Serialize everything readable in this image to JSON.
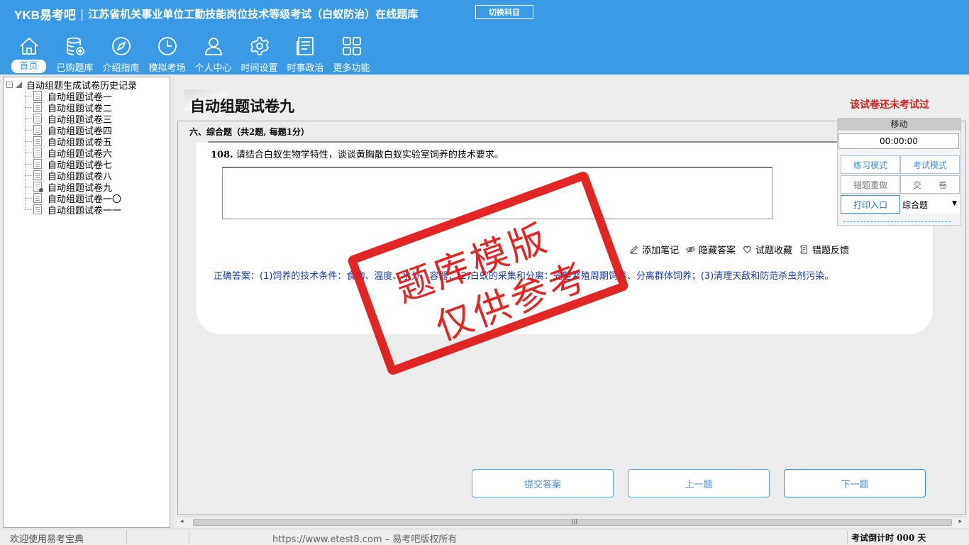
{
  "app": {
    "logo": "YKB易考吧",
    "title": "江苏省机关事业单位工勤技能岗位技术等级考试（白蚁防治）在线题库",
    "switch_subject": "切换科目"
  },
  "nav": {
    "items": [
      {
        "label": "首页",
        "icon": "home-icon"
      },
      {
        "label": "已购题库",
        "icon": "database-icon"
      },
      {
        "label": "介绍指南",
        "icon": "compass-icon"
      },
      {
        "label": "模拟考场",
        "icon": "clock-icon"
      },
      {
        "label": "个人中心",
        "icon": "user-icon"
      },
      {
        "label": "时间设置",
        "icon": "gear-icon"
      },
      {
        "label": "时事政治",
        "icon": "newspaper-icon"
      },
      {
        "label": "更多功能",
        "icon": "grid-icon"
      }
    ],
    "active": "首页"
  },
  "tree": {
    "root": "自动组题生成试卷历史记录",
    "expander": "-",
    "items": [
      "自动组题试卷一",
      "自动组题试卷二",
      "自动组题试卷三",
      "自动组题试卷四",
      "自动组题试卷五",
      "自动组题试卷六",
      "自动组题试卷七",
      "自动组题试卷八",
      "自动组题试卷九",
      "自动组题试卷一〇",
      "自动组题试卷一一"
    ],
    "current": "自动组题试卷九"
  },
  "paper": {
    "title": "自动组题试卷九",
    "status": "该试卷还未考试过",
    "section": "六、综合题（共2题, 每题1分）"
  },
  "question": {
    "number": "108.",
    "text": "请结合白蚁生物学特性，谈谈黄胸散白蚁实验室饲养的技术要求。",
    "answer_value": "",
    "correct_answer": "正确答案：(1)饲养的技术条件：食物、温度、水分、容器；(2)白蚁的采集和分离：完整繁殖周期饲养、分离群体饲养；(3)清理天敌和防范杀虫剂污染。"
  },
  "tools": {
    "note": "添加笔记",
    "hide_answer": "隐藏答案",
    "favorite": "试题收藏",
    "feedback": "错题反馈"
  },
  "actions": {
    "submit": "提交答案",
    "prev": "上一题",
    "next": "下一题"
  },
  "control": {
    "header": "移动",
    "timer": "00:00:00",
    "practice_mode": "练习模式",
    "exam_mode": "考试模式",
    "redo_wrong": "错题重做",
    "hand_in": "交　　卷",
    "print": "打印入口",
    "type_selected": "综合题"
  },
  "watermark": {
    "line1": "题库模版",
    "line2": "仅供参考"
  },
  "statusbar": {
    "welcome": "欢迎使用易考宝典",
    "copyright": "https://www.etest8.com – 易考吧版权所有",
    "countdown": "考试倒计时 000 天"
  },
  "colors": {
    "header_bg": "#3a9ae6",
    "stamp": "#e01414",
    "status_text": "#d41d1d",
    "answer_text": "#1a3aa8"
  }
}
